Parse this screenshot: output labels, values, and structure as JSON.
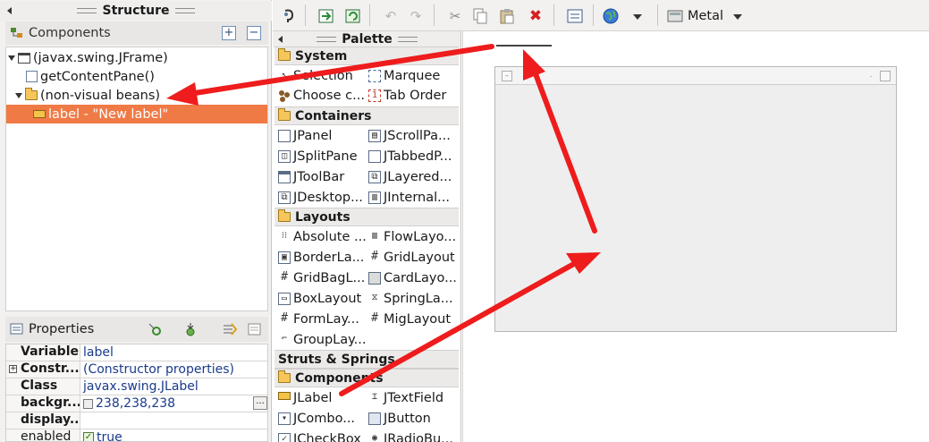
{
  "structure": {
    "title": "Structure",
    "components_label": "Components",
    "tree": [
      {
        "label": "(javax.swing.JFrame)"
      },
      {
        "label": "getContentPane()"
      },
      {
        "label": "(non-visual beans)"
      },
      {
        "label": "label - \"New label\"",
        "selected": true
      }
    ]
  },
  "properties": {
    "title": "Properties",
    "rows": [
      {
        "name": "Variable",
        "value": "label"
      },
      {
        "name": "Constr...",
        "value": "(Constructor properties)"
      },
      {
        "name": "Class",
        "value": "javax.swing.JLabel"
      },
      {
        "name": "backgr...",
        "value": "238,238,238"
      },
      {
        "name": "display...",
        "value": ""
      },
      {
        "name": "enabled",
        "value": "true"
      }
    ]
  },
  "toolbar": {
    "look_and_feel": "Metal"
  },
  "palette": {
    "title": "Palette",
    "categories": {
      "system": "System",
      "containers": "Containers",
      "layouts": "Layouts",
      "struts": "Struts & Springs",
      "components": "Components"
    },
    "system": [
      "Selection",
      "Marquee",
      "Choose c...",
      "Tab Order"
    ],
    "containers": [
      "JPanel",
      "JScrollPa...",
      "JSplitPane",
      "JTabbedP...",
      "JToolBar",
      "JLayered...",
      "JDesktop...",
      "JInternal..."
    ],
    "layouts": [
      "Absolute ...",
      "FlowLayo...",
      "BorderLa...",
      "GridLayout",
      "GridBagL...",
      "CardLayo...",
      "BoxLayout",
      "SpringLa...",
      "FormLay...",
      "MigLayout",
      "GroupLay..."
    ],
    "components": [
      "JLabel",
      "JTextField",
      "JCombo...",
      "JButton",
      "JCheckBox",
      "JRadioBu..."
    ]
  },
  "colors": {
    "selection": "#f07a46",
    "arrow": "#ee1c1c",
    "value_text": "#1a3b8c"
  }
}
